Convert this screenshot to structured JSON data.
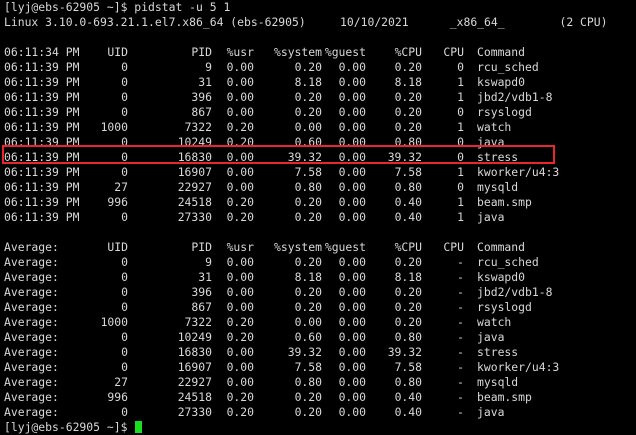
{
  "colors": {
    "background": "#000000",
    "text": "#d8d8d8",
    "highlight_border": "#e8262b",
    "cursor": "#19e01f"
  },
  "prompt_line": "[lyj@ebs-62905 ~]$ pidstat -u 5 1",
  "system_line": "Linux 3.10.0-693.21.1.el7.x86_64 (ebs-62905)     10/10/2021      _x86_64_        (2 CPU)",
  "headers": {
    "time": "06:11:34 PM",
    "uid": "UID",
    "pid": "PID",
    "usr": "%usr",
    "system": "%system",
    "guest": "%guest",
    "cpu": "%CPU",
    "cpu_num": "CPU",
    "command": "Command"
  },
  "samples": [
    {
      "time": "06:11:39 PM",
      "uid": "0",
      "pid": "9",
      "usr": "0.00",
      "system": "0.20",
      "guest": "0.00",
      "cpu": "0.20",
      "cpu_num": "0",
      "command": "rcu_sched"
    },
    {
      "time": "06:11:39 PM",
      "uid": "0",
      "pid": "31",
      "usr": "0.00",
      "system": "8.18",
      "guest": "0.00",
      "cpu": "8.18",
      "cpu_num": "1",
      "command": "kswapd0"
    },
    {
      "time": "06:11:39 PM",
      "uid": "0",
      "pid": "396",
      "usr": "0.00",
      "system": "0.20",
      "guest": "0.00",
      "cpu": "0.20",
      "cpu_num": "1",
      "command": "jbd2/vdb1-8"
    },
    {
      "time": "06:11:39 PM",
      "uid": "0",
      "pid": "867",
      "usr": "0.00",
      "system": "0.20",
      "guest": "0.00",
      "cpu": "0.20",
      "cpu_num": "0",
      "command": "rsyslogd"
    },
    {
      "time": "06:11:39 PM",
      "uid": "1000",
      "pid": "7322",
      "usr": "0.20",
      "system": "0.00",
      "guest": "0.00",
      "cpu": "0.20",
      "cpu_num": "1",
      "command": "watch"
    },
    {
      "time": "06:11:39 PM",
      "uid": "0",
      "pid": "10249",
      "usr": "0.20",
      "system": "0.60",
      "guest": "0.00",
      "cpu": "0.80",
      "cpu_num": "0",
      "command": "java"
    },
    {
      "time": "06:11:39 PM",
      "uid": "0",
      "pid": "16830",
      "usr": "0.00",
      "system": "39.32",
      "guest": "0.00",
      "cpu": "39.32",
      "cpu_num": "0",
      "command": "stress"
    },
    {
      "time": "06:11:39 PM",
      "uid": "0",
      "pid": "16907",
      "usr": "0.00",
      "system": "7.58",
      "guest": "0.00",
      "cpu": "7.58",
      "cpu_num": "1",
      "command": "kworker/u4:3"
    },
    {
      "time": "06:11:39 PM",
      "uid": "27",
      "pid": "22927",
      "usr": "0.00",
      "system": "0.80",
      "guest": "0.00",
      "cpu": "0.80",
      "cpu_num": "0",
      "command": "mysqld"
    },
    {
      "time": "06:11:39 PM",
      "uid": "996",
      "pid": "24518",
      "usr": "0.20",
      "system": "0.20",
      "guest": "0.00",
      "cpu": "0.40",
      "cpu_num": "1",
      "command": "beam.smp"
    },
    {
      "time": "06:11:39 PM",
      "uid": "0",
      "pid": "27330",
      "usr": "0.20",
      "system": "0.20",
      "guest": "0.00",
      "cpu": "0.40",
      "cpu_num": "1",
      "command": "java"
    }
  ],
  "average_headers": {
    "time": "Average:",
    "uid": "UID",
    "pid": "PID",
    "usr": "%usr",
    "system": "%system",
    "guest": "%guest",
    "cpu": "%CPU",
    "cpu_num": "CPU",
    "command": "Command"
  },
  "averages": [
    {
      "time": "Average:",
      "uid": "0",
      "pid": "9",
      "usr": "0.00",
      "system": "0.20",
      "guest": "0.00",
      "cpu": "0.20",
      "cpu_num": "-",
      "command": "rcu_sched"
    },
    {
      "time": "Average:",
      "uid": "0",
      "pid": "31",
      "usr": "0.00",
      "system": "8.18",
      "guest": "0.00",
      "cpu": "8.18",
      "cpu_num": "-",
      "command": "kswapd0"
    },
    {
      "time": "Average:",
      "uid": "0",
      "pid": "396",
      "usr": "0.00",
      "system": "0.20",
      "guest": "0.00",
      "cpu": "0.20",
      "cpu_num": "-",
      "command": "jbd2/vdb1-8"
    },
    {
      "time": "Average:",
      "uid": "0",
      "pid": "867",
      "usr": "0.00",
      "system": "0.20",
      "guest": "0.00",
      "cpu": "0.20",
      "cpu_num": "-",
      "command": "rsyslogd"
    },
    {
      "time": "Average:",
      "uid": "1000",
      "pid": "7322",
      "usr": "0.20",
      "system": "0.00",
      "guest": "0.00",
      "cpu": "0.20",
      "cpu_num": "-",
      "command": "watch"
    },
    {
      "time": "Average:",
      "uid": "0",
      "pid": "10249",
      "usr": "0.20",
      "system": "0.60",
      "guest": "0.00",
      "cpu": "0.80",
      "cpu_num": "-",
      "command": "java"
    },
    {
      "time": "Average:",
      "uid": "0",
      "pid": "16830",
      "usr": "0.00",
      "system": "39.32",
      "guest": "0.00",
      "cpu": "39.32",
      "cpu_num": "-",
      "command": "stress"
    },
    {
      "time": "Average:",
      "uid": "0",
      "pid": "16907",
      "usr": "0.00",
      "system": "7.58",
      "guest": "0.00",
      "cpu": "7.58",
      "cpu_num": "-",
      "command": "kworker/u4:3"
    },
    {
      "time": "Average:",
      "uid": "27",
      "pid": "22927",
      "usr": "0.00",
      "system": "0.80",
      "guest": "0.00",
      "cpu": "0.80",
      "cpu_num": "-",
      "command": "mysqld"
    },
    {
      "time": "Average:",
      "uid": "996",
      "pid": "24518",
      "usr": "0.20",
      "system": "0.20",
      "guest": "0.00",
      "cpu": "0.40",
      "cpu_num": "-",
      "command": "beam.smp"
    },
    {
      "time": "Average:",
      "uid": "0",
      "pid": "27330",
      "usr": "0.20",
      "system": "0.20",
      "guest": "0.00",
      "cpu": "0.40",
      "cpu_num": "-",
      "command": "java"
    }
  ],
  "final_prompt": "[lyj@ebs-62905 ~]$ "
}
